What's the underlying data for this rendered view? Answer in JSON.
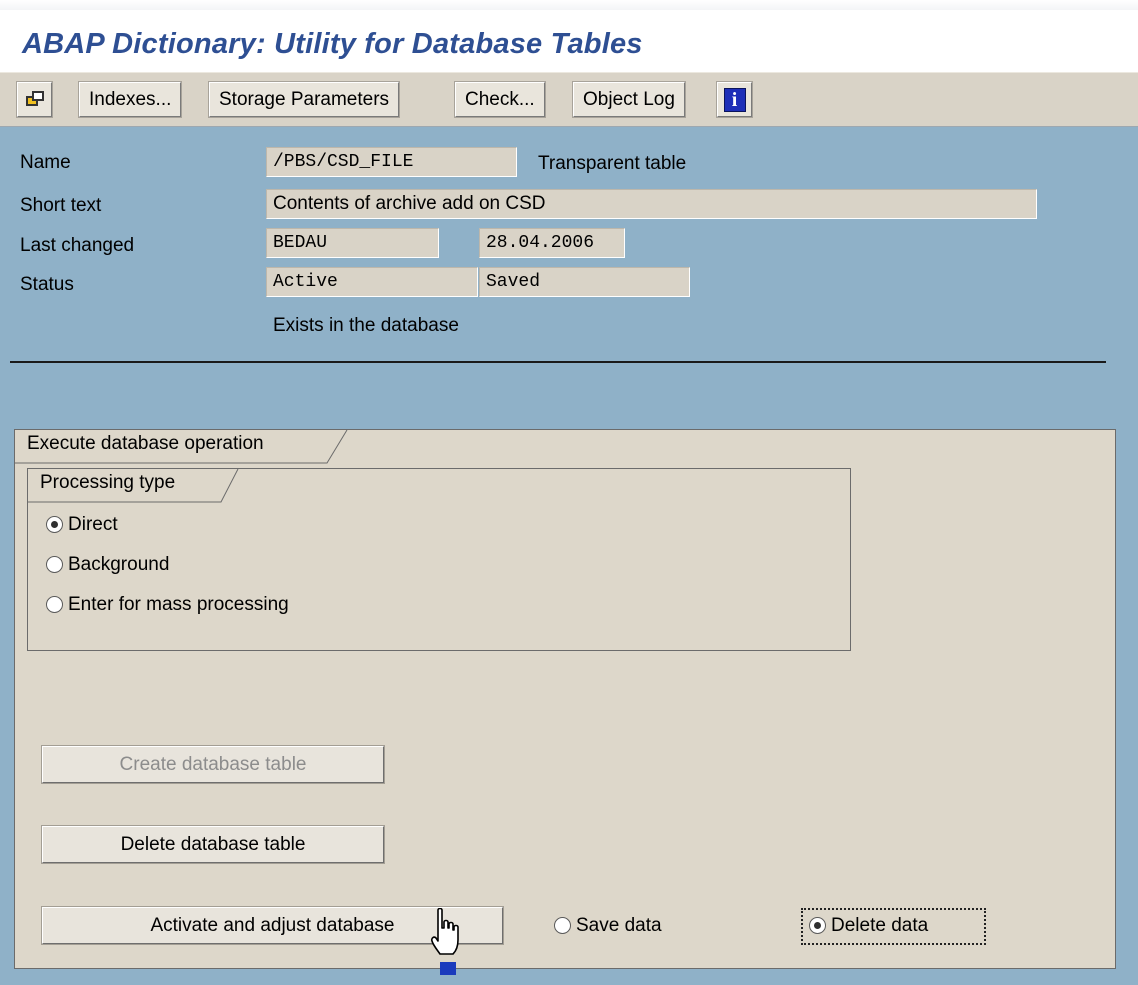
{
  "window": {
    "title": "ABAP Dictionary: Utility for Database Tables"
  },
  "toolbar": {
    "icon_left": "window-switch-icon",
    "indexes": "Indexes...",
    "storage_parameters": "Storage Parameters",
    "check": "Check...",
    "object_log": "Object Log",
    "info_icon": "info-icon",
    "info_glyph": "i"
  },
  "header": {
    "name_label": "Name",
    "name_value": "/PBS/CSD_FILE",
    "table_type": "Transparent table",
    "short_text_label": "Short text",
    "short_text_value": "Contents of archive add on CSD",
    "last_changed_label": "Last changed",
    "last_changed_user": "BEDAU",
    "last_changed_date": "28.04.2006",
    "status_label": "Status",
    "status_value1": "Active",
    "status_value2": "Saved",
    "db_status": "Exists in the database"
  },
  "execute": {
    "group_title": "Execute database operation",
    "processing_title": "Processing type",
    "options": [
      {
        "label": "Direct",
        "selected": true
      },
      {
        "label": "Background",
        "selected": false
      },
      {
        "label": "Enter for mass processing",
        "selected": false
      }
    ],
    "create_btn": "Create database table",
    "delete_btn": "Delete database table",
    "activate_btn": "Activate and adjust database",
    "save_data": "Save data",
    "delete_data": "Delete data",
    "save_data_selected": false,
    "delete_data_selected": true
  },
  "colors": {
    "background": "#8fb1c8",
    "title": "#2e4f93",
    "panel": "#ddd7ca"
  }
}
